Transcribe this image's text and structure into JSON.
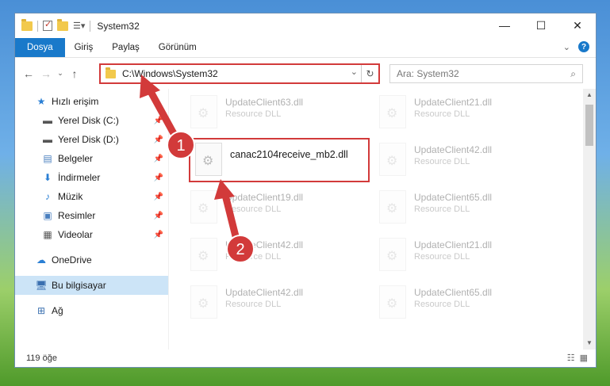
{
  "window": {
    "title": "System32",
    "controls": {
      "minimize": "—",
      "maximize": "☐",
      "close": "✕"
    }
  },
  "ribbon": {
    "tabs": [
      {
        "label": "Dosya",
        "active": true
      },
      {
        "label": "Giriş"
      },
      {
        "label": "Paylaş"
      },
      {
        "label": "Görünüm"
      }
    ],
    "help": "?"
  },
  "address": {
    "path": "C:\\Windows\\System32",
    "search_placeholder": "Ara: System32"
  },
  "sidebar": {
    "quick_access": "Hızlı erişim",
    "items": [
      {
        "label": "Yerel Disk (C:)",
        "icon": "drive-icon",
        "pinned": true
      },
      {
        "label": "Yerel Disk (D:)",
        "icon": "drive-icon",
        "pinned": true
      },
      {
        "label": "Belgeler",
        "icon": "documents-icon",
        "pinned": true
      },
      {
        "label": "İndirmeler",
        "icon": "downloads-icon",
        "pinned": true
      },
      {
        "label": "Müzik",
        "icon": "music-icon",
        "pinned": true
      },
      {
        "label": "Resimler",
        "icon": "pictures-icon",
        "pinned": true
      },
      {
        "label": "Videolar",
        "icon": "videos-icon",
        "pinned": true
      }
    ],
    "onedrive": "OneDrive",
    "this_pc": "Bu bilgisayar",
    "network": "Ağ"
  },
  "files": {
    "left_column": [
      {
        "name": "UpdateClient63.dll",
        "type": "Resource DLL",
        "faded": true
      },
      {
        "name": "canac2104receive_mb2.dll",
        "type": "",
        "faded": false,
        "highlighted": true
      },
      {
        "name": "UpdateClient19.dll",
        "type": "Resource DLL",
        "faded": true
      },
      {
        "name": "UpdateClient42.dll",
        "type": "Resource DLL",
        "faded": true
      },
      {
        "name": "UpdateClient42.dll",
        "type": "Resource DLL",
        "faded": true
      }
    ],
    "right_column": [
      {
        "name": "UpdateClient21.dll",
        "type": "Resource DLL",
        "faded": true
      },
      {
        "name": "UpdateClient42.dll",
        "type": "Resource DLL",
        "faded": true
      },
      {
        "name": "UpdateClient65.dll",
        "type": "Resource DLL",
        "faded": true
      },
      {
        "name": "UpdateClient21.dll",
        "type": "Resource DLL",
        "faded": true
      },
      {
        "name": "UpdateClient65.dll",
        "type": "Resource DLL",
        "faded": true
      }
    ]
  },
  "status": {
    "count": "119 öğe"
  },
  "annotations": [
    {
      "number": "1",
      "color": "#d23a3a"
    },
    {
      "number": "2",
      "color": "#d23a3a"
    }
  ]
}
